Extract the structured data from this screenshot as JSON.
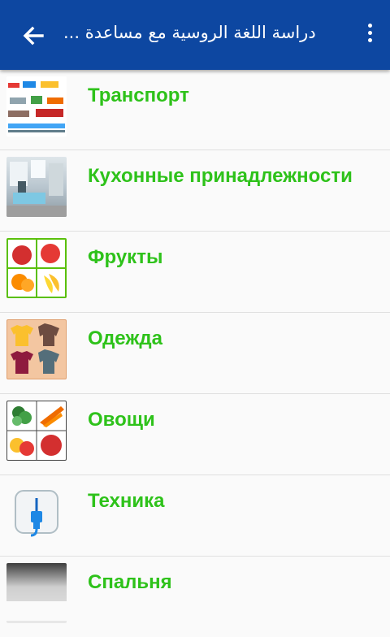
{
  "appbar": {
    "title": "دراسة اللغة الروسية مع مساعدة ...",
    "back_icon": "arrow-left-icon",
    "menu_icon": "more-vertical-icon",
    "color": "#0d47a1"
  },
  "categories": [
    {
      "label": "Транспорт",
      "icon": "transport-thumbnail"
    },
    {
      "label": "Кухонные принадлежности",
      "icon": "kitchen-thumbnail"
    },
    {
      "label": "Фрукты",
      "icon": "fruits-thumbnail"
    },
    {
      "label": "Одежда",
      "icon": "clothes-thumbnail"
    },
    {
      "label": "Овощи",
      "icon": "vegetables-thumbnail"
    },
    {
      "label": "Техника",
      "icon": "plug-thumbnail"
    },
    {
      "label": "Спальня",
      "icon": "bedroom-thumbnail"
    }
  ],
  "label_color": "#2ec21a"
}
